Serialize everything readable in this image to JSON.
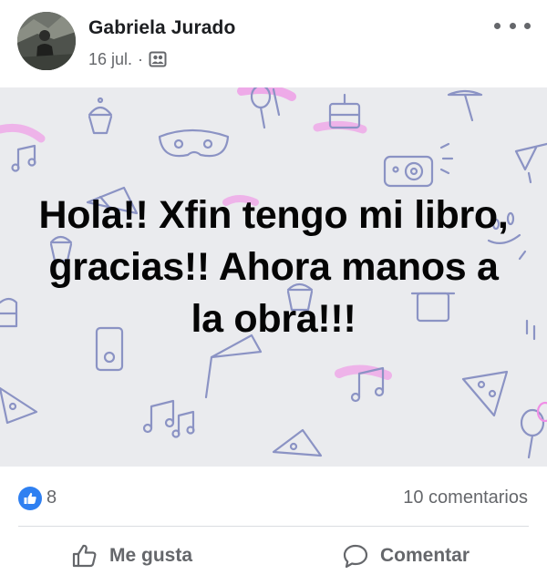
{
  "post": {
    "author_name": "Gabriela Jurado",
    "date": "16 jul.",
    "separator": "·",
    "audience_icon": "friends-icon",
    "text": "Hola!! Xfin tengo mi libro, gracias!! Ahora manos a la obra!!!",
    "background_theme": "party-doodles"
  },
  "reactions": {
    "icon": "like-icon",
    "count": "8",
    "comments_label": "10 comentarios"
  },
  "actions": {
    "like_label": "Me gusta",
    "comment_label": "Comentar"
  },
  "colors": {
    "like_blue": "#2f80f1",
    "secondary_text": "#65676b",
    "doodle_stroke": "#8b93c4",
    "doodle_pink": "#f08ee6"
  }
}
